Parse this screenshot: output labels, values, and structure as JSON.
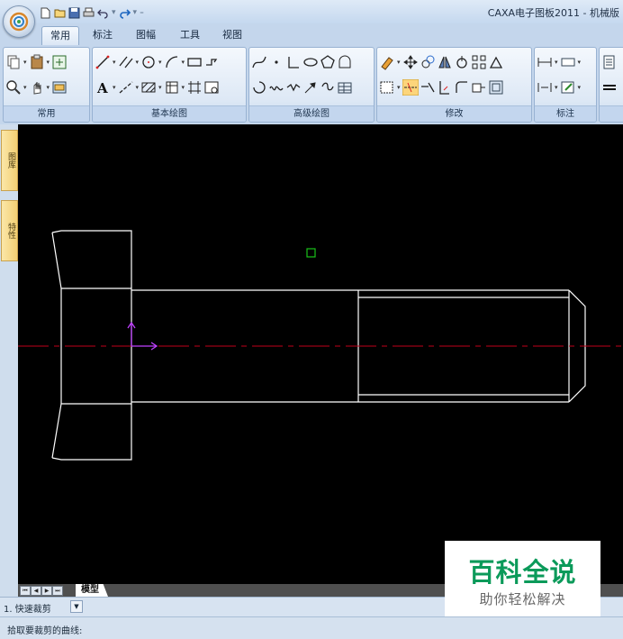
{
  "window": {
    "title": "CAXA电子图板2011 - 机械版"
  },
  "quick_access": {
    "icons": [
      "new-file-icon",
      "open-file-icon",
      "save-icon",
      "print-icon",
      "undo-icon",
      "redo-icon",
      "customize-qat-icon"
    ]
  },
  "tabs": [
    {
      "label": "常用",
      "active": true
    },
    {
      "label": "标注",
      "active": false
    },
    {
      "label": "图幅",
      "active": false
    },
    {
      "label": "工具",
      "active": false
    },
    {
      "label": "视图",
      "active": false
    }
  ],
  "ribbon": {
    "groups": [
      {
        "label": "常用"
      },
      {
        "label": "基本绘图"
      },
      {
        "label": "高级绘图"
      },
      {
        "label": "修改"
      },
      {
        "label": "标注"
      },
      {
        "label": ""
      }
    ]
  },
  "left_panels": [
    {
      "label": "图库"
    },
    {
      "label": "特性"
    }
  ],
  "colors": {
    "canvas": "#000000",
    "geometry": "#ffffff",
    "centerline": "#c0001a",
    "ucs": "#c040ff",
    "snap_marker": "#19c219",
    "watermark": "#0b9a5a"
  },
  "sheet_tabs": {
    "model": "模型"
  },
  "command_bar": {
    "label": "1. 快速裁剪"
  },
  "status_bar": {
    "prompt": "拾取要裁剪的曲线:"
  },
  "watermark": {
    "main": "百科全说",
    "sub": "助你轻松解决"
  }
}
